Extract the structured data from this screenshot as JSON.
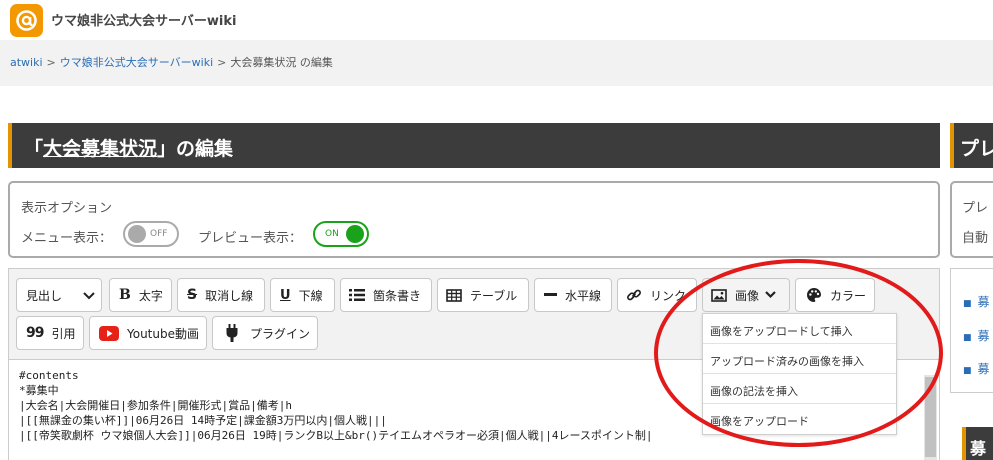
{
  "site": {
    "title": "ウマ娘非公式大会サーバーwiki"
  },
  "breadcrumb": {
    "root": "atwiki",
    "sep1": ">",
    "wiki": "ウマ娘非公式大会サーバーwiki",
    "sep2": ">",
    "current": "大会募集状況 の編集"
  },
  "heading": {
    "open": "「",
    "page": "大会募集状況",
    "close": "」の編集"
  },
  "preview_heading": "プレ",
  "options": {
    "title": "表示オプション",
    "menu_label": "メニュー表示：",
    "menu_toggle": "OFF",
    "preview_label": "プレビュー表示：",
    "preview_toggle": "ON"
  },
  "preview_options": {
    "line1": "プレ",
    "line2": "自動"
  },
  "toolbar": {
    "heading_select": "見出し",
    "bold": "太字",
    "bold_icon": "B",
    "strike": "取消し線",
    "strike_icon": "S",
    "underline": "下線",
    "underline_icon": "U",
    "bullet": "箇条書き",
    "table": "テーブル",
    "hr": "水平線",
    "link": "リンク",
    "image": "画像",
    "color": "カラー",
    "quote": "引用",
    "quote_icon": "99",
    "youtube": "Youtube動画",
    "plugin": "プラグイン"
  },
  "image_menu": [
    {
      "label": "画像をアップロードして挿入"
    },
    {
      "label": "アップロード済みの画像を挿入"
    },
    {
      "label": "画像の記法を挿入"
    },
    {
      "label": "画像をアップロード"
    }
  ],
  "editor": {
    "lines": [
      "#contents",
      "",
      "*募集中",
      "|大会名|大会開催日|参加条件|開催形式|賞品|備考|h",
      "|[[無課金の集い杯]]|06月26日 14時予定|課金額3万円以内|個人戦|||",
      "|[[帝笑歌劇杯 ウマ娘個人大会]]|06月26日 19時|ランクB以上&br()テイエムオペラオー必須|個人戦||4レースポイント制|"
    ]
  },
  "preview_list": [
    "募",
    "募",
    "募"
  ],
  "preview_h2": "募",
  "colors": {
    "accent": "#e39400",
    "heading_bg": "#3c3c3c",
    "toggle_on": "#1aa31a",
    "link": "#2a6db5",
    "annotation": "#e21a1a"
  }
}
